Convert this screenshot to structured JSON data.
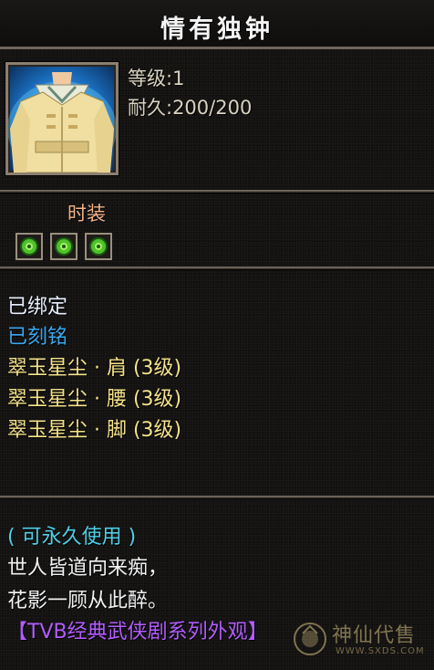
{
  "item": {
    "name": "情有独钟",
    "level_line": "等级:1",
    "durability_line": "耐久:200/200",
    "icon": "costume-robe-icon",
    "type_label": "时装",
    "gem_slots": [
      {
        "icon": "green-gem-icon"
      },
      {
        "icon": "green-gem-icon"
      },
      {
        "icon": "green-gem-icon"
      }
    ]
  },
  "properties": [
    {
      "text": "已绑定",
      "color": "#e8f0ff"
    },
    {
      "text": "已刻铭",
      "color": "#3aa8f0"
    },
    {
      "text": "翠玉星尘 · 肩 (3级)",
      "color": "#f5e28a"
    },
    {
      "text": "翠玉星尘 · 腰 (3级)",
      "color": "#f5e28a"
    },
    {
      "text": "翠玉星尘 · 脚 (3级)",
      "color": "#f5e28a"
    }
  ],
  "description": {
    "usage": "( 可永久使用 )",
    "usage_color": "#4fd0e8",
    "line1": "世人皆道向来痴，",
    "line2": "花影一顾从此醉。",
    "text_color": "#f2f2f2",
    "series": "【TVB经典武侠剧系列外观】",
    "series_color": "#b35cff"
  },
  "watermark": {
    "cn": "神仙代售",
    "url": "WWW.SXDS.COM"
  }
}
